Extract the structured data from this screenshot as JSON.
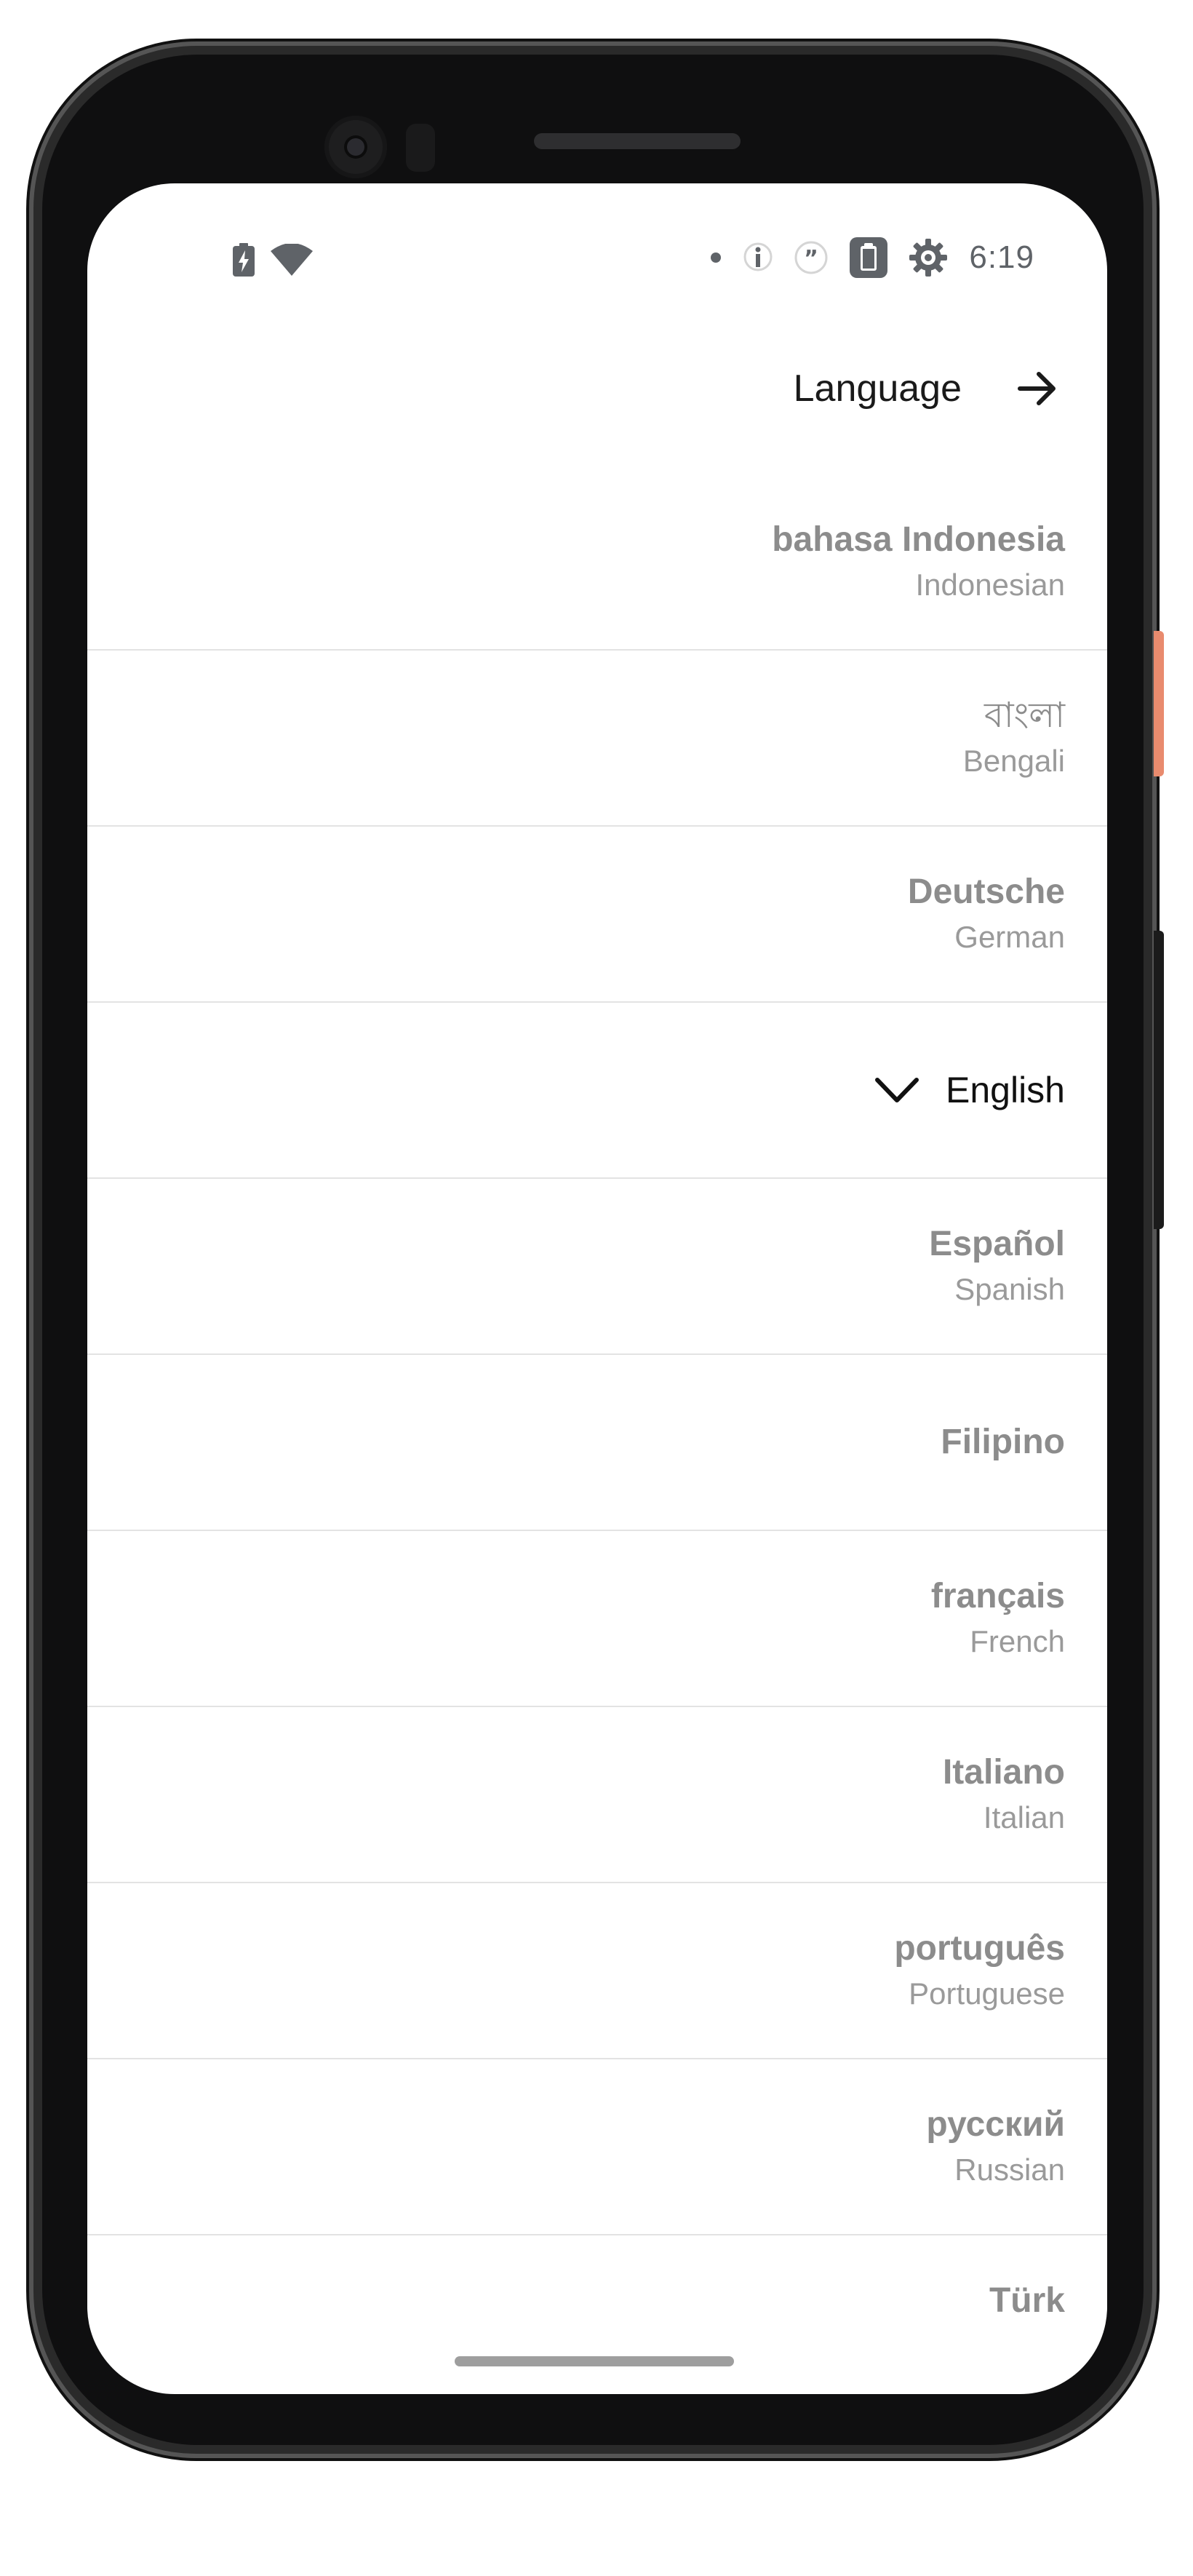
{
  "status_bar": {
    "time": "6:19",
    "left_icons": [
      "battery-charging-icon",
      "wifi-icon"
    ],
    "right_icons": [
      "notification-dot-icon",
      "info-icon",
      "quote-icon",
      "clipboard-icon",
      "settings-gear-icon"
    ]
  },
  "header": {
    "title": "Language",
    "arrow_icon": "arrow-right-icon"
  },
  "languages": [
    {
      "native": "bahasa Indonesia",
      "english": "Indonesian",
      "selected": false
    },
    {
      "native": "বাংলা",
      "english": "Bengali",
      "selected": false
    },
    {
      "native": "Deutsche",
      "english": "German",
      "selected": false
    },
    {
      "native": "English",
      "english": "",
      "selected": true
    },
    {
      "native": "Español",
      "english": "Spanish",
      "selected": false
    },
    {
      "native": "Filipino",
      "english": "",
      "selected": false
    },
    {
      "native": "français",
      "english": "French",
      "selected": false
    },
    {
      "native": "Italiano",
      "english": "Italian",
      "selected": false
    },
    {
      "native": "português",
      "english": "Portuguese",
      "selected": false
    },
    {
      "native": "русский",
      "english": "Russian",
      "selected": false
    },
    {
      "native": "Türk",
      "english": "",
      "selected": false
    }
  ],
  "colors": {
    "accent_side_button": "#e98b6e",
    "selected_text": "#111111",
    "muted_text": "#8c8c8c"
  }
}
